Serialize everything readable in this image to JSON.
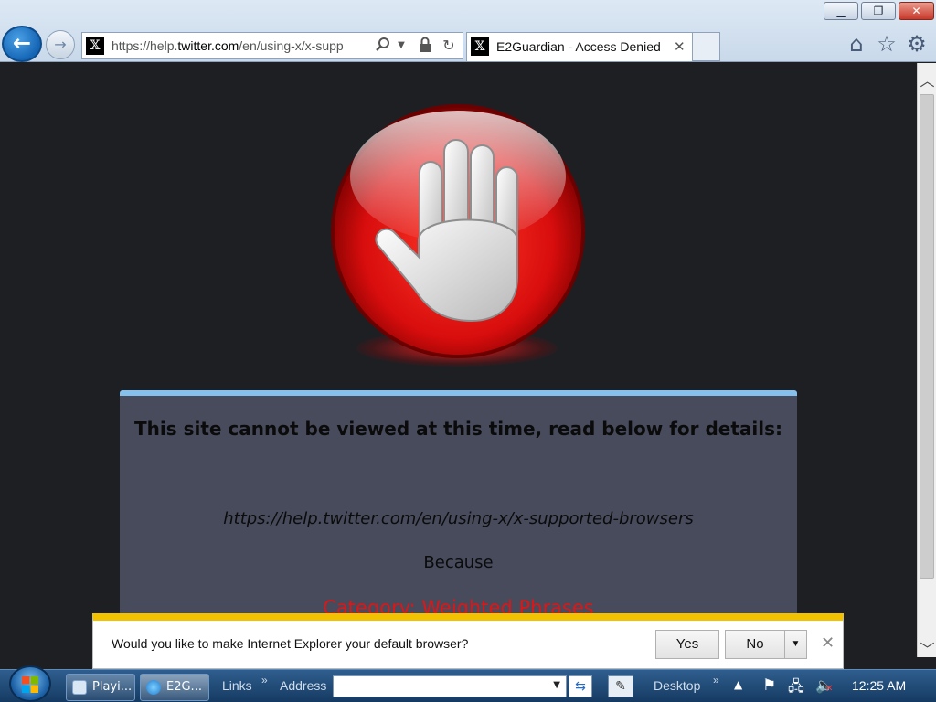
{
  "window": {
    "minimize_glyph": "▁",
    "maximize_glyph": "❐",
    "close_glyph": "✕"
  },
  "nav": {
    "back_glyph": "←",
    "forward_glyph": "→"
  },
  "address_bar": {
    "url_prefix": "https://help.",
    "url_host": "twitter.com",
    "url_rest": "/en/using-x/x-supp",
    "favicon": "𝕏"
  },
  "tab": {
    "title": "E2Guardian - Access Denied",
    "favicon": "𝕏",
    "close_glyph": "✕"
  },
  "toolbar_icons": {
    "home": "⌂",
    "favorites": "☆",
    "tools": "⚙"
  },
  "page": {
    "heading": "This site cannot be viewed at this time, read below for details:",
    "blocked_url": "https://help.twitter.com/en/using-x/x-supported-browsers",
    "because": "Because",
    "category": "Category: Weighted Phrases"
  },
  "notification": {
    "message": "Would you like to make Internet Explorer your default browser?",
    "yes_label": "Yes",
    "no_label": "No"
  },
  "taskbar": {
    "items": [
      {
        "label": "Playi..."
      },
      {
        "label": "E2G..."
      }
    ],
    "links_label": "Links",
    "address_label": "Address",
    "desktop_label": "Desktop",
    "chevron": "»",
    "clock": "12:25 AM"
  },
  "colors": {
    "page_background": "#1e1f23",
    "panel_background": "#474b5c",
    "panel_accent": "#86c1ee",
    "category_red": "#e01515",
    "notification_accent": "#f2c200"
  }
}
